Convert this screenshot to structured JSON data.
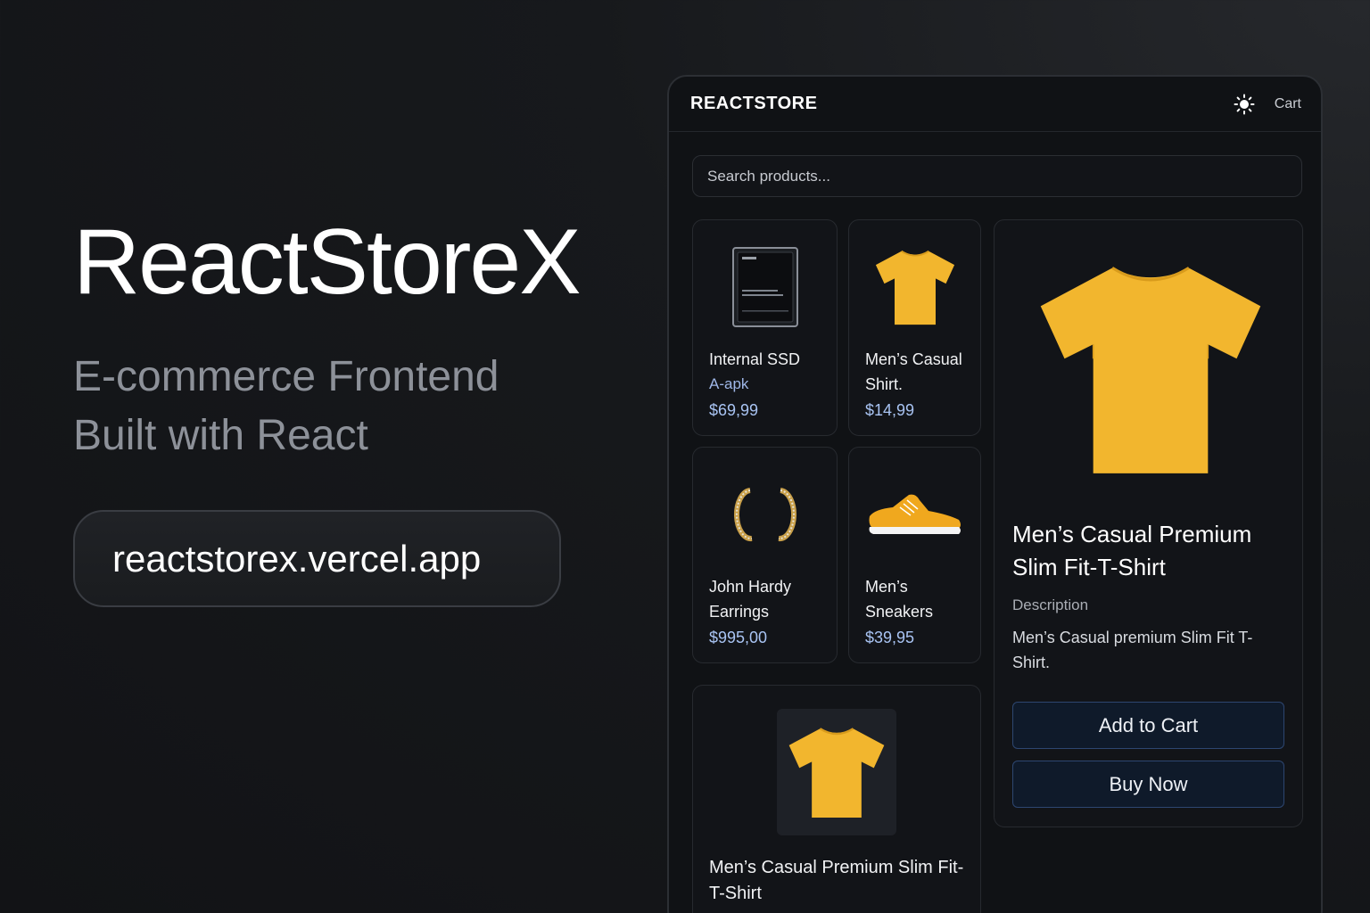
{
  "hero": {
    "title": "ReactStoreX",
    "subtitle_line1": "E-commerce Frontend",
    "subtitle_line2": "Built with React",
    "url": "reactstorex.vercel.app"
  },
  "store": {
    "brand": "REACTSTORE",
    "theme_icon": "sun-icon",
    "cart_label": "Cart",
    "search_placeholder": "Search products...",
    "products": [
      {
        "name": "Internal SSD",
        "sub": "A-apk",
        "price": "$69,99",
        "icon": "ssd-icon"
      },
      {
        "name": "Men’s Casual Shirt.",
        "price": "$14,99",
        "icon": "tshirt-icon"
      },
      {
        "name": "John Hardy Earrings",
        "price": "$995,00",
        "icon": "earrings-icon"
      },
      {
        "name": "Men’s Sneakers",
        "price": "$39,95",
        "icon": "sneaker-icon"
      },
      {
        "name": "Men’s Casual Premium Slim Fit-T-Shirt",
        "icon": "tshirt-icon"
      }
    ],
    "detail": {
      "title": "Men’s Casual Premium Slim Fit-T-Shirt",
      "description_label": "Description",
      "description": "Men’s Casual premium Slim Fit T-Shirt.",
      "add_to_cart_label": "Add to Cart",
      "buy_now_label": "Buy Now"
    }
  },
  "colors": {
    "background": "#15171a",
    "panel": "#101215",
    "accent_price": "#a9c4f3",
    "button_bg": "#0f1a2a",
    "product_yellow": "#f2b62e"
  }
}
